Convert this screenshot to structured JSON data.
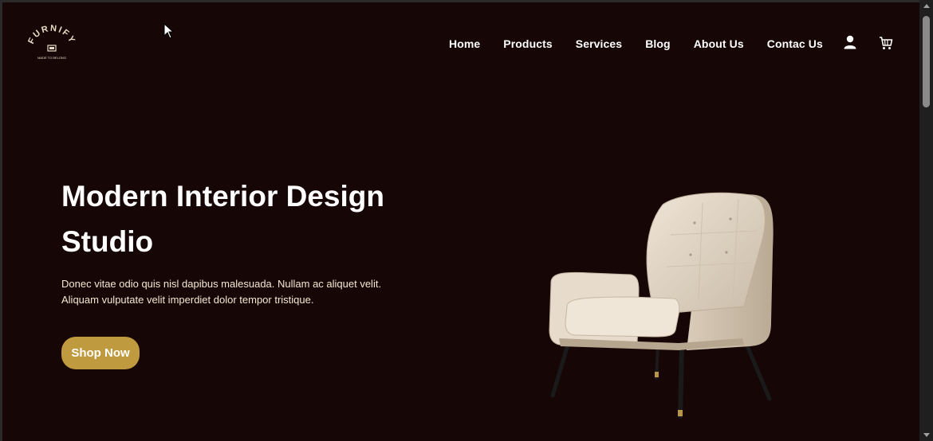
{
  "header": {
    "logo_text": "FURNIFY",
    "logo_tagline": "MADE TO BELONG",
    "nav": [
      {
        "label": "Home"
      },
      {
        "label": "Products"
      },
      {
        "label": "Services"
      },
      {
        "label": "Blog"
      },
      {
        "label": "About Us"
      },
      {
        "label": "Contac Us"
      }
    ],
    "icons": [
      "user-icon",
      "cart-icon"
    ]
  },
  "hero": {
    "title_line1": "Modern Interior Design",
    "title_line2": "Studio",
    "text_line1": "Donec vitae odio quis nisl dapibus malesuada. Nullam ac aliquet velit.",
    "text_line2": "Aliquam vulputate velit imperdiet dolor tempor tristique.",
    "button_label": "Shop Now"
  },
  "colors": {
    "background": "#170606",
    "accent": "#c09a3e",
    "text": "#ffffff",
    "body_text": "#f3e9d2"
  }
}
